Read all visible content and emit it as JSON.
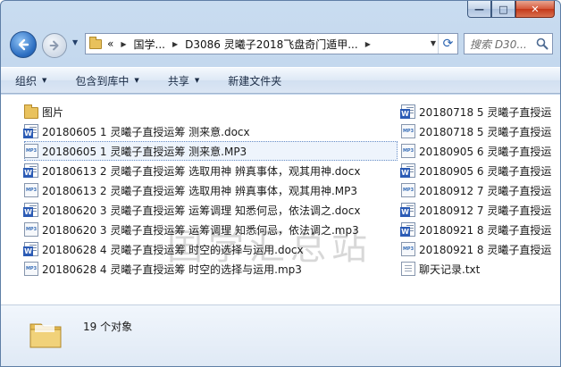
{
  "window": {
    "caption_buttons": {
      "minimize": "—",
      "maximize": "□",
      "close": "✕"
    }
  },
  "nav": {
    "breadcrumb": [
      "«",
      "国学...",
      "D3086 灵曦子2018飞盘奇门遁甲..."
    ],
    "search_placeholder": "搜索 D30..."
  },
  "toolbar": {
    "items": [
      {
        "label": "组织",
        "has_menu": true
      },
      {
        "label": "包含到库中",
        "has_menu": true
      },
      {
        "label": "共享",
        "has_menu": true
      },
      {
        "label": "新建文件夹",
        "has_menu": false
      }
    ]
  },
  "files": {
    "column1": [
      {
        "name": "图片",
        "type": "folder"
      },
      {
        "name": "20180605 1 灵曦子直授运筹 测来意.docx",
        "type": "docx"
      },
      {
        "name": "20180605 1 灵曦子直授运筹 测来意.MP3",
        "type": "mp3",
        "selected": true
      },
      {
        "name": "20180613 2 灵曦子直授运筹 选取用神 辨真事体，观其用神.docx",
        "type": "docx"
      },
      {
        "name": "20180613 2 灵曦子直授运筹 选取用神 辨真事体，观其用神.MP3",
        "type": "mp3"
      },
      {
        "name": "20180620 3 灵曦子直授运筹 运筹调理 知悉何忌，依法调之.docx",
        "type": "docx"
      },
      {
        "name": "20180620 3 灵曦子直授运筹 运筹调理 知悉何忌，依法调之.mp3",
        "type": "mp3"
      },
      {
        "name": "20180628 4 灵曦子直授运筹 时空的选择与运用.docx",
        "type": "docx"
      },
      {
        "name": "20180628 4 灵曦子直授运筹 时空的选择与运用.mp3",
        "type": "mp3"
      }
    ],
    "column2": [
      {
        "name": "20180718 5 灵曦子直授运",
        "type": "docx"
      },
      {
        "name": "20180718 5 灵曦子直授运",
        "type": "mp3"
      },
      {
        "name": "20180905 6 灵曦子直授运",
        "type": "mp3"
      },
      {
        "name": "20180905 6 灵曦子直授运",
        "type": "docx"
      },
      {
        "name": "20180912 7 灵曦子直授运",
        "type": "mp3"
      },
      {
        "name": "20180912 7 灵曦子直授运",
        "type": "docx"
      },
      {
        "name": "20180921 8 灵曦子直授运",
        "type": "docx"
      },
      {
        "name": "20180921 8 灵曦子直授运",
        "type": "mp3"
      },
      {
        "name": "聊天记录.txt",
        "type": "txt"
      }
    ]
  },
  "watermark": "国学汇总站",
  "status": {
    "count_label": "19 个对象"
  }
}
